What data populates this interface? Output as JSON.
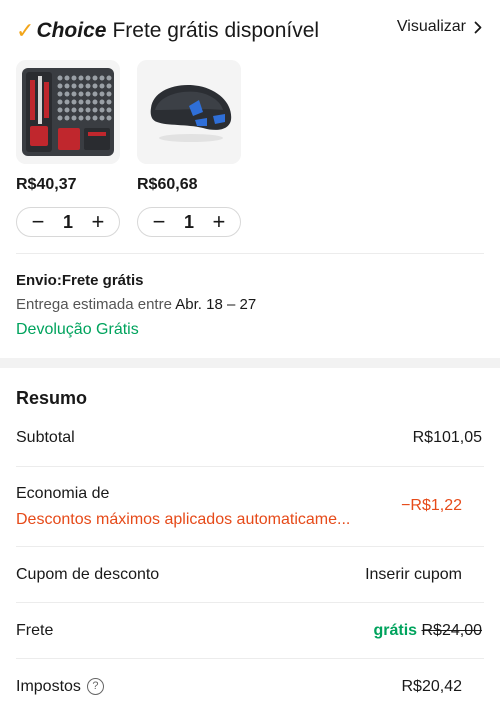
{
  "header": {
    "check_glyph": "✓",
    "choice_label": "Choice",
    "title_rest": "Frete grátis disponível",
    "view_label": "Visualizar"
  },
  "products": [
    {
      "name_icon": "screwdriver-set-image",
      "price": "R$40,37",
      "qty": "1"
    },
    {
      "name_icon": "gaming-mouse-image",
      "price": "R$60,68",
      "qty": "1"
    }
  ],
  "stepper": {
    "minus": "−",
    "plus": "+"
  },
  "shipping": {
    "title": "Envio:Frete grátis",
    "delivery_prefix": "Entrega estimada entre",
    "delivery_dates": "Abr. 18 – 27",
    "free_return": "Devolução Grátis"
  },
  "summary": {
    "title": "Resumo",
    "subtotal_label": "Subtotal",
    "subtotal_value": "R$101,05",
    "savings_label": "Economia de",
    "savings_sub": "Descontos máximos aplicados automaticame...",
    "savings_value": "−R$1,22",
    "coupon_label": "Cupom de desconto",
    "coupon_action": "Inserir cupom",
    "freight_label": "Frete",
    "freight_free": "grátis",
    "freight_old": "R$24,00",
    "tax_label": "Impostos",
    "tax_value": "R$20,42"
  },
  "colors": {
    "accent_green": "#00a35d",
    "discount_red": "#e64a19",
    "choice_orange": "#f2a51a"
  }
}
